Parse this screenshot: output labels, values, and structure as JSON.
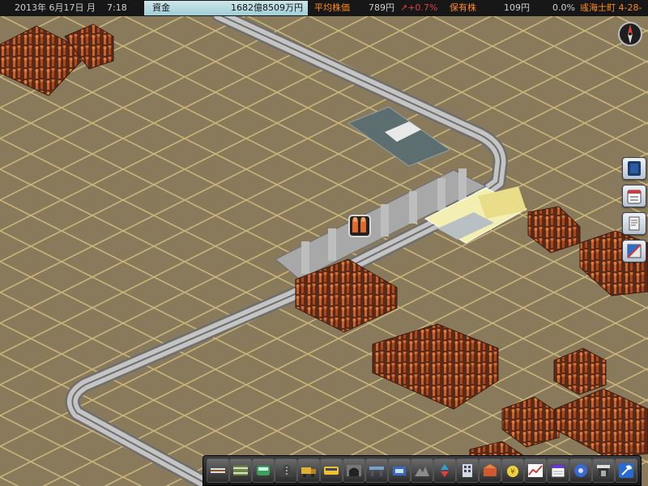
{
  "status_bar": {
    "date": "2013年 6月17日 月",
    "time": "7:18",
    "funds_label": "資金",
    "funds_value": "1682億8509万円",
    "avg_stock_label": "平均株価",
    "avg_stock_value": "789円",
    "avg_stock_change": "↗+0.7%",
    "shares_label": "保有株",
    "shares_value": "109円",
    "shares_pct": "0.0%",
    "location": "彧海士町 4-28-"
  },
  "side_buttons": [
    "notebook-icon",
    "schedule-board-icon",
    "report-icon",
    "map-icon"
  ],
  "toolbar_icons": [
    "rail-track-icon",
    "double-track-icon",
    "train-icon",
    "road-icon",
    "truck-icon",
    "bus-icon",
    "tunnel-icon",
    "bridge-icon",
    "vehicle-depot-icon",
    "terrain-icon",
    "raise-lower-icon",
    "building-icon",
    "subsidiary-icon",
    "finance-icon",
    "graph-icon",
    "calendar-icon",
    "settings-icon",
    "station-icon",
    "tools-icon"
  ],
  "colors": {
    "ground": "#8a7a5c",
    "grid": "#c8b27a",
    "rail": "#b9b9b9",
    "funds_bg": "#b7dbe2",
    "stock_up": "#e04040"
  }
}
